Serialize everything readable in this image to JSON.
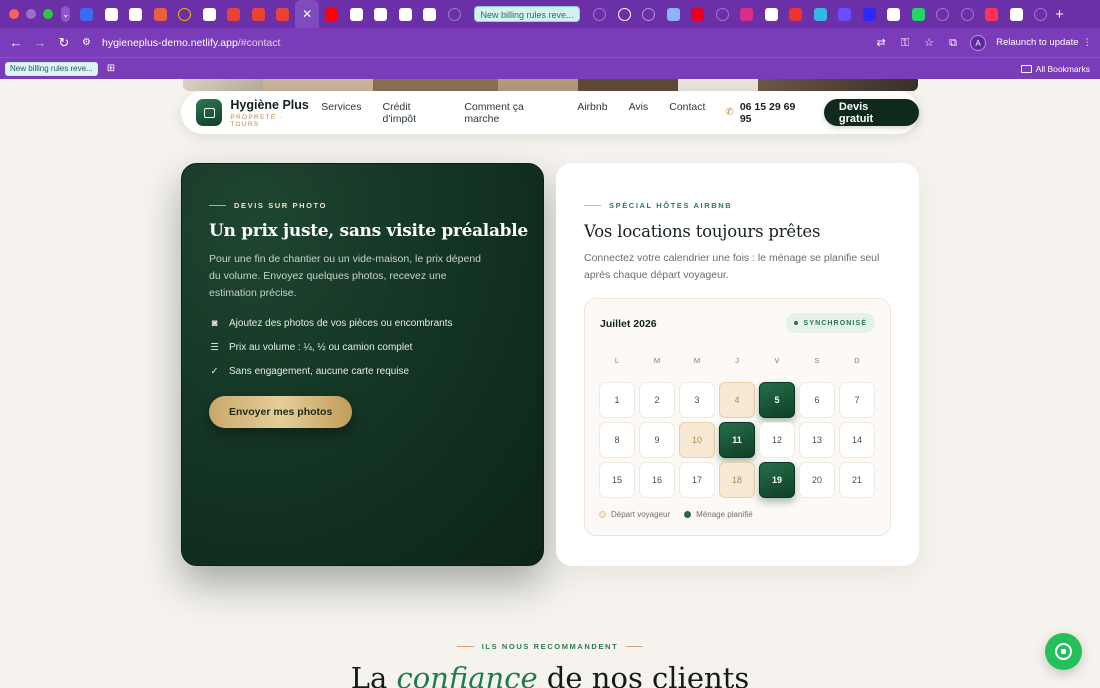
{
  "browser": {
    "active_tab_title": "New billing rules reve...",
    "url_host": "hygieneplus-demo.netlify.app",
    "url_path": "/#contact",
    "relaunch_label": "Relaunch to update",
    "profile_initial": "A",
    "bookmark_pill": "New billing rules reve...",
    "all_bookmarks": "All Bookmarks",
    "tab_favicons": [
      {
        "icon": "arc-icon",
        "color": "#3b6cf0"
      },
      {
        "icon": "chrome-icon",
        "color": "#ffffff"
      },
      {
        "icon": "chrome-icon",
        "color": "#ffffff"
      },
      {
        "icon": "notes-icon",
        "color": "#e8603c"
      },
      {
        "icon": "circle-icon",
        "color": "#f5b400"
      },
      {
        "icon": "chrome-icon",
        "color": "#ffffff"
      },
      {
        "icon": "gmail-icon",
        "color": "#ea4335"
      },
      {
        "icon": "gmail-icon",
        "color": "#ea4335"
      },
      {
        "icon": "gmail-icon",
        "color": "#ea4335"
      },
      {
        "icon": "close-icon",
        "color": "#ffffff"
      }
    ],
    "tab_favicons_right": [
      {
        "icon": "youtube-icon",
        "color": "#ff0000"
      },
      {
        "icon": "app-icon",
        "color": "#ffffff"
      },
      {
        "icon": "app-icon",
        "color": "#ffffff"
      },
      {
        "icon": "notion-icon",
        "color": "#ffffff"
      },
      {
        "icon": "z-icon",
        "color": "#ffffff"
      },
      {
        "icon": "loading-icon",
        "color": "#9a7fc0"
      }
    ],
    "tab_favicons_after": [
      {
        "icon": "loading-icon",
        "color": "#9a7fc0"
      },
      {
        "icon": "circle-icon",
        "color": "#ffffff"
      },
      {
        "icon": "circle-icon",
        "color": "#b592e0"
      },
      {
        "icon": "sparkle-icon",
        "color": "#8ab4f8"
      },
      {
        "icon": "pinterest-icon",
        "color": "#e60023"
      },
      {
        "icon": "loading-icon",
        "color": "#9a7fc0"
      },
      {
        "icon": "instagram-icon",
        "color": "#d8308a"
      },
      {
        "icon": "app-icon",
        "color": "#ffffff"
      },
      {
        "icon": "heart-icon",
        "color": "#e33"
      },
      {
        "icon": "s-icon",
        "color": "#35b8e0"
      },
      {
        "icon": "dot-icon",
        "color": "#6b4cff"
      },
      {
        "icon": "dot-icon",
        "color": "#2a2aff"
      },
      {
        "icon": "triangle-icon",
        "color": "#ffffff"
      },
      {
        "icon": "whatsapp-icon",
        "color": "#25d366"
      },
      {
        "icon": "loading-icon",
        "color": "#9a7fc0"
      },
      {
        "icon": "loading-icon",
        "color": "#9a7fc0"
      },
      {
        "icon": "app-icon",
        "color": "#ff3355"
      },
      {
        "icon": "app-icon",
        "color": "#ffffff"
      },
      {
        "icon": "loading-icon",
        "color": "#9a7fc0"
      }
    ]
  },
  "site": {
    "brand_name": "Hygiène Plus",
    "brand_tagline": "PROPRETÉ · TOURS",
    "nav": [
      "Services",
      "Crédit d'impôt",
      "Comment ça marche",
      "Airbnb",
      "Avis",
      "Contact"
    ],
    "phone": "06 15 29 69 95",
    "cta": "Devis gratuit"
  },
  "photo_card": {
    "eyebrow": "DEVIS SUR PHOTO",
    "title": "Un prix juste, sans visite préalable",
    "lead": "Pour une fin de chantier ou un vide-maison, le prix dépend du volume. Envoyez quelques photos, recevez une estimation précise.",
    "features": [
      {
        "icon": "camera-icon",
        "text": "Ajoutez des photos de vos pièces ou encombrants"
      },
      {
        "icon": "list-icon",
        "text": "Prix au volume : ¼, ½ ou camion complet"
      },
      {
        "icon": "check-icon",
        "text": "Sans engagement, aucune carte requise"
      }
    ],
    "button": "Envoyer mes photos"
  },
  "airbnb_card": {
    "eyebrow": "SPÉCIAL HÔTES AIRBNB",
    "title": "Vos locations toujours prêtes",
    "lead": "Connectez votre calendrier une fois : le ménage se planifie seul après chaque départ voyageur.",
    "calendar": {
      "month": "Juillet 2026",
      "badge": "SYNCHRONISÉ",
      "weekdays": [
        "L",
        "M",
        "M",
        "J",
        "V",
        "S",
        "D"
      ],
      "days": [
        {
          "n": "1",
          "state": ""
        },
        {
          "n": "2",
          "state": ""
        },
        {
          "n": "3",
          "state": ""
        },
        {
          "n": "4",
          "state": "depart"
        },
        {
          "n": "5",
          "state": "clean"
        },
        {
          "n": "6",
          "state": ""
        },
        {
          "n": "7",
          "state": ""
        },
        {
          "n": "8",
          "state": ""
        },
        {
          "n": "9",
          "state": ""
        },
        {
          "n": "10",
          "state": "depart"
        },
        {
          "n": "11",
          "state": "clean"
        },
        {
          "n": "12",
          "state": ""
        },
        {
          "n": "13",
          "state": ""
        },
        {
          "n": "14",
          "state": ""
        },
        {
          "n": "15",
          "state": ""
        },
        {
          "n": "16",
          "state": ""
        },
        {
          "n": "17",
          "state": ""
        },
        {
          "n": "18",
          "state": "depart"
        },
        {
          "n": "19",
          "state": "clean"
        },
        {
          "n": "20",
          "state": ""
        },
        {
          "n": "21",
          "state": ""
        }
      ],
      "legend_depart": "Départ voyageur",
      "legend_clean": "Ménage planifié"
    }
  },
  "testimonials": {
    "eyebrow": "ILS NOUS RECOMMANDENT",
    "title_before": "La",
    "title_em": "confiance",
    "title_after": "de nos clients"
  },
  "colors": {
    "chrome_purple": "#7a3cb8",
    "forest": "#123222",
    "gold": "#c8a869",
    "accent_green": "#1f7a4c"
  }
}
